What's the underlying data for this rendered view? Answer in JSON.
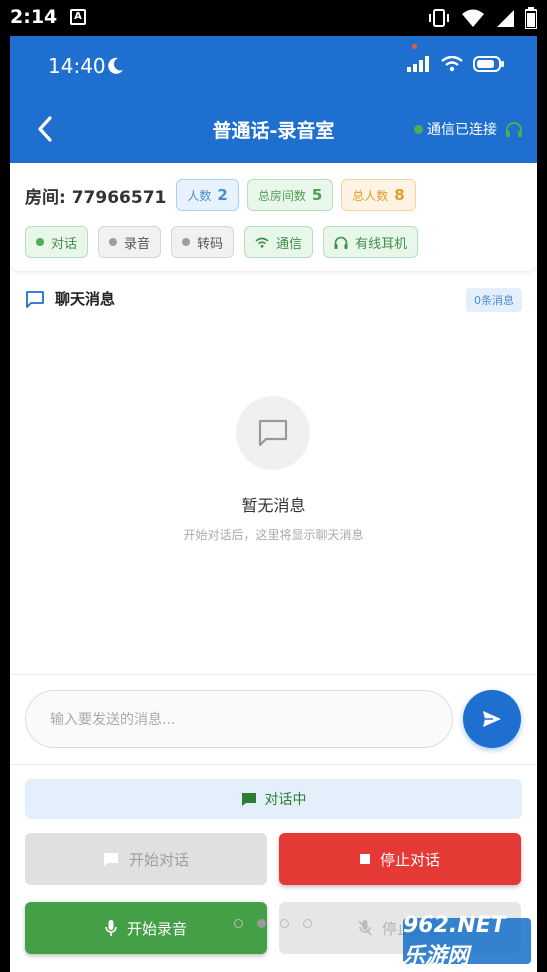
{
  "system_status": {
    "time": "2:14",
    "notification_glyph": "A"
  },
  "inner_status": {
    "time": "14:40"
  },
  "header": {
    "title": "普通话-录音室",
    "connection": "通信已连接",
    "accent": "#1e6fd0"
  },
  "room": {
    "label": "房间: 77966571",
    "stats": [
      {
        "label": "人数",
        "value": "2"
      },
      {
        "label": "总房间数",
        "value": "5"
      },
      {
        "label": "总人数",
        "value": "8"
      }
    ],
    "statuses": [
      {
        "label": "对话",
        "state": "active",
        "icon": "dot-icon"
      },
      {
        "label": "录音",
        "state": "inactive",
        "icon": "dot-icon"
      },
      {
        "label": "转码",
        "state": "inactive",
        "icon": "dot-icon"
      },
      {
        "label": "通信",
        "state": "active",
        "icon": "wifi-icon"
      },
      {
        "label": "有线耳机",
        "state": "active",
        "icon": "headphones-icon"
      }
    ]
  },
  "chat": {
    "title": "聊天消息",
    "count": "0条消息",
    "empty_title": "暂无消息",
    "empty_subtitle": "开始对话后，这里将显示聊天消息"
  },
  "composer": {
    "placeholder": "输入要发送的消息..."
  },
  "controls": {
    "status": "对话中",
    "start_talk": "开始对话",
    "stop_talk": "停止对话",
    "start_record": "开始录音",
    "stop_record": "停止录音"
  },
  "watermark": "962.NET 乐游网"
}
